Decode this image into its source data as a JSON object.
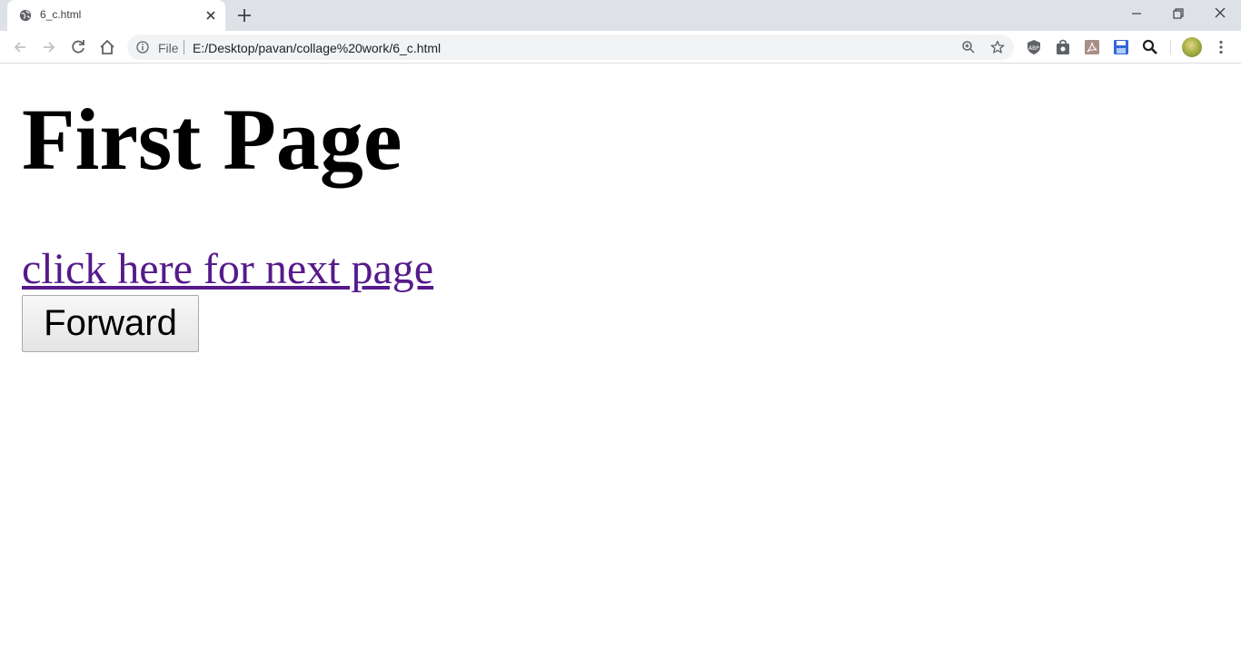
{
  "browser": {
    "tab": {
      "title": "6_c.html",
      "favicon": "globe-icon",
      "close_icon": "close-icon"
    },
    "new_tab_icon": "plus-icon",
    "window_controls": [
      "minimize-icon",
      "restore-icon",
      "close-icon"
    ],
    "nav": {
      "back": "arrow-left-icon",
      "forward": "arrow-right-icon",
      "reload": "reload-icon",
      "home": "home-icon"
    },
    "omnibox": {
      "info_icon": "info-icon",
      "scheme": "File",
      "url": "E:/Desktop/pavan/collage%20work/6_c.html",
      "zoom_icon": "zoom-icon",
      "bookmark_icon": "star-icon"
    },
    "extensions": [
      "shield-icon",
      "bag-icon",
      "pdf-icon",
      "save-icon",
      "search-extension-icon"
    ],
    "menu_icon": "more-vertical-icon"
  },
  "page": {
    "heading": "First Page",
    "link_text": "click here for next page",
    "button_label": "Forward"
  },
  "colors": {
    "link_visited": "#551a8b",
    "tabstrip_bg": "#dee1e6",
    "omnibox_bg": "#f1f3f4"
  }
}
